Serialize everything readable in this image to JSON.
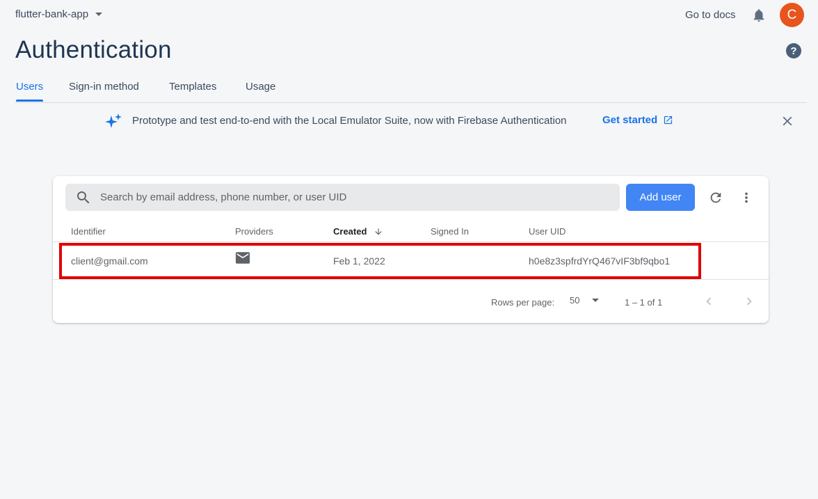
{
  "header": {
    "project_name": "flutter-bank-app",
    "docs_link": "Go to docs",
    "avatar_initial": "C",
    "avatar_color": "#e8541d"
  },
  "page": {
    "title": "Authentication"
  },
  "tabs": [
    {
      "label": "Users",
      "active": true
    },
    {
      "label": "Sign-in method",
      "active": false
    },
    {
      "label": "Templates",
      "active": false
    },
    {
      "label": "Usage",
      "active": false
    }
  ],
  "banner": {
    "text": "Prototype and test end-to-end with the Local Emulator Suite, now with Firebase Authentication",
    "cta": "Get started",
    "icon": "sparkle-icon"
  },
  "users_table": {
    "search_placeholder": "Search by email address, phone number, or user UID",
    "add_user_label": "Add user",
    "columns": [
      "Identifier",
      "Providers",
      "Created",
      "Signed In",
      "User UID"
    ],
    "sorted_column": "Created",
    "rows": [
      {
        "identifier": "client@gmail.com",
        "provider_icon": "email-icon",
        "created": "Feb 1, 2022",
        "signed_in": "",
        "uid": "h0e8z3spfrdYrQ467vIF3bf9qbo1"
      }
    ],
    "pagination": {
      "rows_per_page_label": "Rows per page:",
      "rows_per_page_value": "50",
      "range_text": "1 – 1 of 1"
    }
  },
  "colors": {
    "accent": "#1a73e8",
    "button": "#4285f4",
    "highlight": "#e20000",
    "title": "#1f3551"
  }
}
